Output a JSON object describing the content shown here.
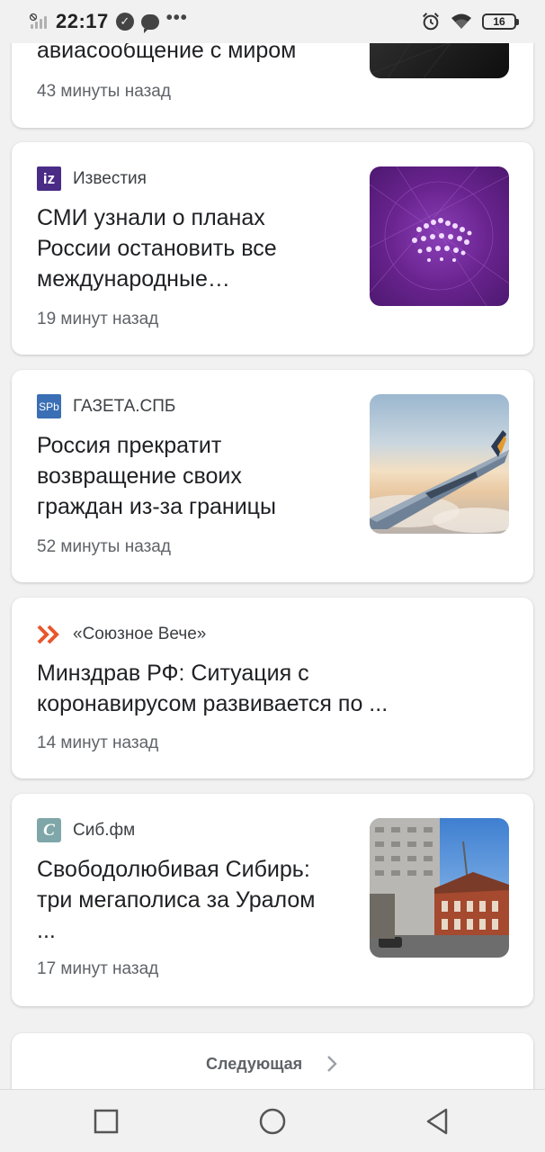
{
  "status_bar": {
    "time": "22:17",
    "battery": "16",
    "icons": [
      "no-sim-signal-icon",
      "check-circle-icon",
      "message-bubble-icon",
      "more-dots-icon",
      "alarm-icon",
      "wifi-icon",
      "battery-icon"
    ]
  },
  "feed": {
    "items": [
      {
        "source": "",
        "headline_lines": [
          "авиасообщение с миром"
        ],
        "time": "43 минуты назад",
        "thumbnail": "dark-abstract-image"
      },
      {
        "source": "Известия",
        "logo_text": "iz",
        "logo_color": "#4a2c86",
        "headline_lines": [
          "СМИ узнали о планах",
          "России остановить все",
          "международные…"
        ],
        "time": "19 минут назад",
        "thumbnail": "purple-crowd-image"
      },
      {
        "source": "ГАЗЕТА.СПБ",
        "logo_text": "SPb",
        "logo_color": "#3a6fb5",
        "headline_lines": [
          "Россия прекратит",
          "возвращение своих",
          "граждан из-за границы"
        ],
        "time": "52 минуты назад",
        "thumbnail": "airplane-wing-image"
      },
      {
        "source": "«Союзное Вече»",
        "logo_color": "#e8562a",
        "headline_lines": [
          "Минздрав РФ: Ситуация с",
          "коронавирусом развивается по ..."
        ],
        "time": "14 минут назад",
        "thumbnail": ""
      },
      {
        "source": "Сиб.фм",
        "logo_text": "C",
        "logo_color": "#7fa6a8",
        "headline_lines": [
          "Свободолюбивая Сибирь:",
          "три мегаполиса за Уралом",
          "..."
        ],
        "time": "17 минут назад",
        "thumbnail": "city-buildings-image"
      }
    ],
    "next_label": "Следующая"
  },
  "nav": {
    "icons": [
      "recent-apps-icon",
      "home-icon",
      "back-icon"
    ]
  }
}
